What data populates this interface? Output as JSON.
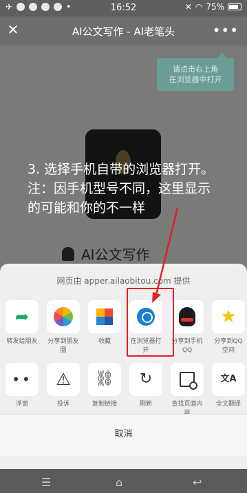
{
  "status_bar": {
    "time": "16:52",
    "battery": "75%"
  },
  "title_bar": {
    "title": "AI公文写作 - AI老笔头",
    "close_icon": "close-icon",
    "more_icon": "more-icon"
  },
  "webpage": {
    "tooltip_line1": "请点击右上角",
    "tooltip_line2": "在浏览器中打开",
    "app_name": "AI公文写作"
  },
  "instruction": {
    "line1": "3. 选择手机自带的浏览器打开。",
    "line2": "注：因手机型号不同，这里显示",
    "line3": "的可能和你的不一样"
  },
  "sheet": {
    "header": "网页由 apper.ailaobitou.com 提供",
    "row1": [
      {
        "label": "转发给朋友",
        "icon": "share-icon"
      },
      {
        "label": "分享到朋友圈",
        "icon": "moments-icon"
      },
      {
        "label": "收藏",
        "icon": "favorite-icon"
      },
      {
        "label": "在浏览器打开",
        "icon": "browser-icon"
      },
      {
        "label": "分享到手机QQ",
        "icon": "qq-icon"
      },
      {
        "label": "分享到QQ空间",
        "icon": "qzone-icon"
      }
    ],
    "row2": [
      {
        "label": "浮窗",
        "icon": "float-window-icon"
      },
      {
        "label": "投诉",
        "icon": "warning-icon"
      },
      {
        "label": "复制链接",
        "icon": "link-icon"
      },
      {
        "label": "刷新",
        "icon": "refresh-icon"
      },
      {
        "label": "查找页面内容",
        "icon": "search-page-icon"
      },
      {
        "label": "全文翻译",
        "icon": "translate-icon"
      }
    ],
    "cancel": "取消"
  },
  "colors": {
    "highlight": "#e42020",
    "tooltip": "#6b9c95"
  }
}
